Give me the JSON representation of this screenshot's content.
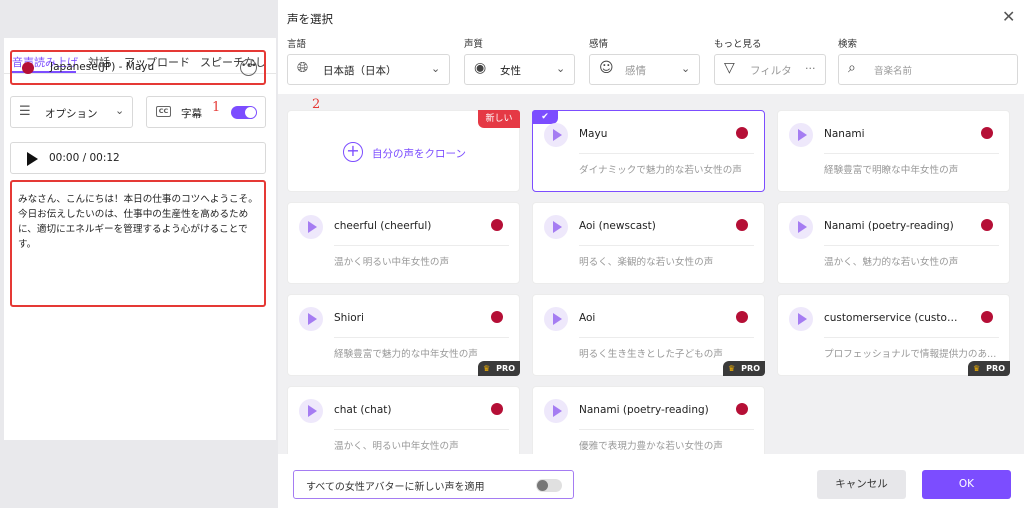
{
  "left": {
    "tabs": [
      "音声読み上げ",
      "対話",
      "アップロード",
      "スピーチなし"
    ],
    "selected_voice": "Japanese(JP) - Mayu",
    "annotation_1": "1",
    "options_label": "オプション",
    "subtitle_label": "字幕",
    "player_time": "00:00 / 00:12",
    "script_text": "みなさん、こんにちは！本日の仕事のコツへようこそ。\n今日お伝えしたいのは、仕事中の生産性を高めるために、適切にエネルギーを管理するよう心がけることです。"
  },
  "modal": {
    "title": "声を選択",
    "filters": {
      "language_label": "言語",
      "language_value": "日本語（日本）",
      "gender_label": "声質",
      "gender_value": "女性",
      "emotion_label": "感情",
      "emotion_value": "感情",
      "more_label": "もっと見る",
      "more_value": "フィルタ",
      "more_dots": "···",
      "search_label": "検索",
      "search_placeholder": "音楽名前"
    },
    "annotation_2": "2",
    "clone_card": {
      "label": "自分の声をクローン",
      "badge": "新しい"
    },
    "voices": [
      {
        "name": "Mayu",
        "desc": "ダイナミックで魅力的な若い女性の声"
      },
      {
        "name": "Nanami",
        "desc": "経験豊富で明瞭な中年女性の声"
      },
      {
        "name": "cheerful (cheerful)",
        "desc": "温かく明るい中年女性の声"
      },
      {
        "name": "Aoi (newscast)",
        "desc": "明るく、楽観的な若い女性の声"
      },
      {
        "name": "Nanami (poetry-reading)",
        "desc": "温かく、魅力的な若い女性の声"
      },
      {
        "name": "Shiori",
        "desc": "経験豊富で魅力的な中年女性の声"
      },
      {
        "name": "Aoi",
        "desc": "明るく生き生きとした子どもの声"
      },
      {
        "name": "customerservice (customer...",
        "desc": "プロフェッショナルで情報提供力のあ..."
      },
      {
        "name": "chat (chat)",
        "desc": "温かく、明るい中年女性の声"
      },
      {
        "name": "Nanami (poetry-reading)",
        "desc": "優雅で表現力豊かな若い女性の声"
      }
    ],
    "pro_label": "PRO",
    "footer": {
      "apply_all_label": "すべての女性アバターに新しい声を適用",
      "cancel": "キャンセル",
      "ok": "OK"
    }
  },
  "colors": {
    "accent": "#7c4dff",
    "highlight_red": "#e53935",
    "flag_red": "#b50f36"
  }
}
